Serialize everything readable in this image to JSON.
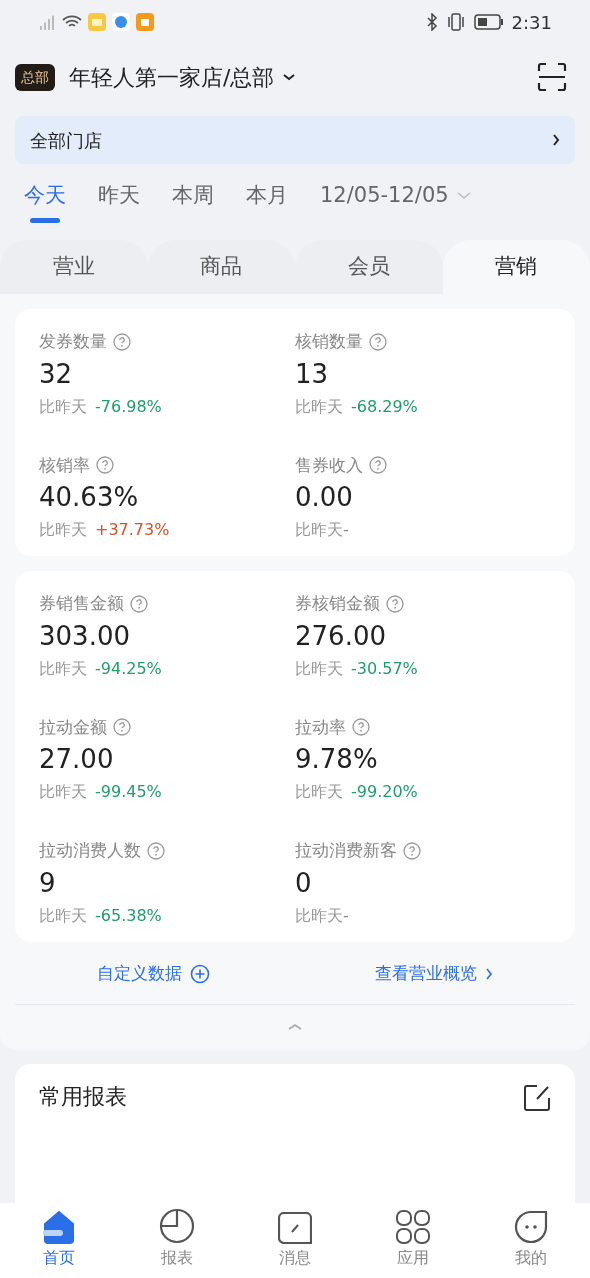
{
  "status_bar": {
    "time": "2:31"
  },
  "header": {
    "badge": "总部",
    "title": "年轻人第一家店/总部"
  },
  "store_filter": {
    "label": "全部门店"
  },
  "date_tabs": [
    {
      "label": "今天",
      "selected": true
    },
    {
      "label": "昨天",
      "selected": false
    },
    {
      "label": "本周",
      "selected": false
    },
    {
      "label": "本月",
      "selected": false
    },
    {
      "label": "12/05-12/05",
      "selected": false,
      "kind": "range"
    }
  ],
  "module_tabs": [
    {
      "label": "营业",
      "selected": false
    },
    {
      "label": "商品",
      "selected": false
    },
    {
      "label": "会员",
      "selected": false
    },
    {
      "label": "营销",
      "selected": true
    }
  ],
  "cards": [
    {
      "metrics": [
        {
          "label": "发券数量",
          "value": "32",
          "compare": "比昨天",
          "change": "-76.98%",
          "kind": "down"
        },
        {
          "label": "核销数量",
          "value": "13",
          "compare": "比昨天",
          "change": "-68.29%",
          "kind": "down"
        },
        {
          "label": "核销率",
          "value": "40.63%",
          "compare": "比昨天",
          "change": "+37.73%",
          "kind": "up"
        },
        {
          "label": "售券收入",
          "value": "0.00",
          "compare": "比昨天",
          "change": "-",
          "kind": "none"
        }
      ]
    },
    {
      "metrics": [
        {
          "label": "券销售金额",
          "value": "303.00",
          "compare": "比昨天",
          "change": "-94.25%",
          "kind": "down"
        },
        {
          "label": "券核销金额",
          "value": "276.00",
          "compare": "比昨天",
          "change": "-30.57%",
          "kind": "down"
        },
        {
          "label": "拉动金额",
          "value": "27.00",
          "compare": "比昨天",
          "change": "-99.45%",
          "kind": "down"
        },
        {
          "label": "拉动率",
          "value": "9.78%",
          "compare": "比昨天",
          "change": "-99.20%",
          "kind": "down"
        },
        {
          "label": "拉动消费人数",
          "value": "9",
          "compare": "比昨天",
          "change": "-65.38%",
          "kind": "down"
        },
        {
          "label": "拉动消费新客",
          "value": "0",
          "compare": "比昨天",
          "change": "-",
          "kind": "none"
        }
      ]
    }
  ],
  "links": {
    "customize": "自定义数据",
    "overview": "查看营业概览"
  },
  "reports": {
    "title": "常用报表"
  },
  "bottom_nav": [
    {
      "label": "首页",
      "selected": true,
      "kind": "home"
    },
    {
      "label": "报表",
      "selected": false,
      "kind": "chart"
    },
    {
      "label": "消息",
      "selected": false,
      "kind": "message"
    },
    {
      "label": "应用",
      "selected": false,
      "kind": "apps"
    },
    {
      "label": "我的",
      "selected": false,
      "kind": "me"
    }
  ]
}
